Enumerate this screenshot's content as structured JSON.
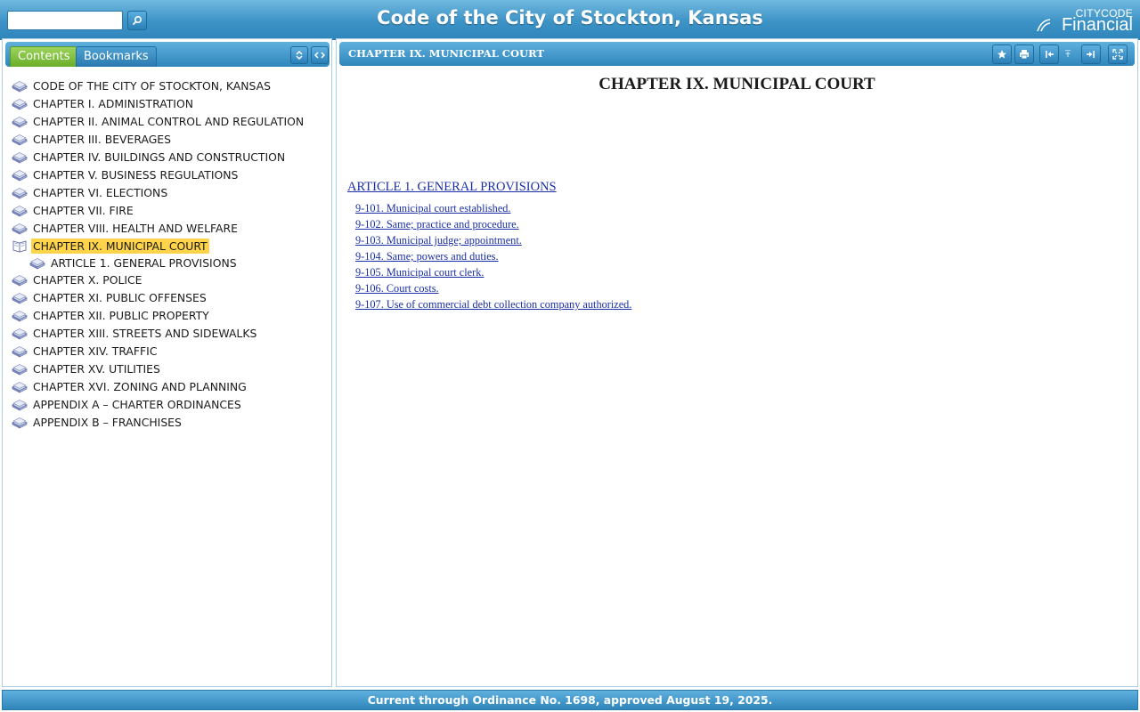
{
  "header": {
    "title": "Code of the City of Stockton, Kansas",
    "search_placeholder": "",
    "search_icon": "search-icon",
    "brand_top": "CITYCODE",
    "brand_bottom": "Financial"
  },
  "left_panel": {
    "tabs": [
      "Contents",
      "Bookmarks"
    ],
    "active_tab": "Contents",
    "buttons": [
      "expand-collapse-icon",
      "sync-icon"
    ],
    "toc": [
      {
        "label": "CODE OF THE CITY OF STOCKTON, KANSAS",
        "icon": "book-icon"
      },
      {
        "label": "CHAPTER I. ADMINISTRATION",
        "icon": "book-icon"
      },
      {
        "label": "CHAPTER II. ANIMAL CONTROL AND REGULATION",
        "icon": "book-icon"
      },
      {
        "label": "CHAPTER III. BEVERAGES",
        "icon": "book-icon"
      },
      {
        "label": "CHAPTER IV. BUILDINGS AND CONSTRUCTION",
        "icon": "book-icon"
      },
      {
        "label": "CHAPTER V. BUSINESS REGULATIONS",
        "icon": "book-icon"
      },
      {
        "label": "CHAPTER VI. ELECTIONS",
        "icon": "book-icon"
      },
      {
        "label": "CHAPTER VII. FIRE",
        "icon": "book-icon"
      },
      {
        "label": "CHAPTER VIII. HEALTH AND WELFARE",
        "icon": "book-icon"
      },
      {
        "label": "CHAPTER IX. MUNICIPAL COURT",
        "icon": "open-book-icon",
        "selected": true
      },
      {
        "label": "ARTICLE 1. GENERAL PROVISIONS",
        "icon": "book-icon",
        "sub": true
      },
      {
        "label": "CHAPTER X. POLICE",
        "icon": "book-icon"
      },
      {
        "label": "CHAPTER XI. PUBLIC OFFENSES",
        "icon": "book-icon"
      },
      {
        "label": "CHAPTER XII. PUBLIC PROPERTY",
        "icon": "book-icon"
      },
      {
        "label": "CHAPTER XIII. STREETS AND SIDEWALKS",
        "icon": "book-icon"
      },
      {
        "label": "CHAPTER XIV. TRAFFIC",
        "icon": "book-icon"
      },
      {
        "label": "CHAPTER XV. UTILITIES",
        "icon": "book-icon"
      },
      {
        "label": "CHAPTER XVI. ZONING AND PLANNING",
        "icon": "book-icon"
      },
      {
        "label": "APPENDIX A – CHARTER ORDINANCES",
        "icon": "book-icon"
      },
      {
        "label": "APPENDIX B – FRANCHISES",
        "icon": "book-icon"
      }
    ]
  },
  "right_panel": {
    "bar_title": "CHAPTER IX. MUNICIPAL COURT",
    "toolbar_icons": [
      "bookmark-star-icon",
      "print-icon",
      "previous-icon",
      "up-icon",
      "next-icon",
      "fullscreen-icon"
    ],
    "heading": "CHAPTER IX. MUNICIPAL COURT",
    "article_link": "ARTICLE 1. GENERAL PROVISIONS",
    "sections": [
      "9-101. Municipal court established.",
      "9-102. Same; practice and procedure.",
      "9-103. Municipal judge; appointment.",
      "9-104. Same; powers and duties.",
      "9-105. Municipal court clerk.",
      "9-106. Court costs.",
      "9-107. Use of commercial debt collection company authorized."
    ]
  },
  "footer": {
    "text": "Current through Ordinance No. 1698, approved August 19, 2025."
  },
  "colors": {
    "header_blue": "#3d93c6",
    "selected_highlight": "#ffd44a",
    "link_blue": "#1a2fa8",
    "tab_active_green": "#6aae2a"
  }
}
